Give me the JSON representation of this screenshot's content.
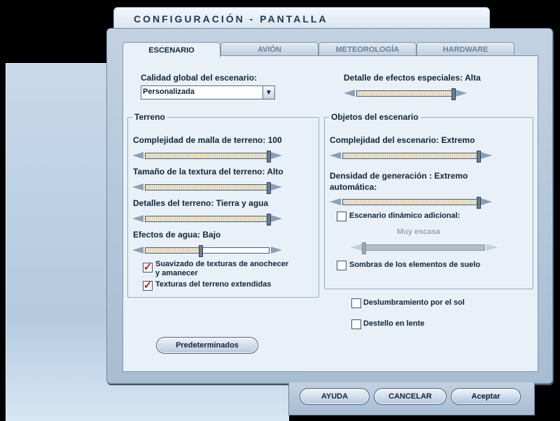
{
  "window": {
    "title": "CONFIGURACIÓN - PANTALLA"
  },
  "tabs": [
    {
      "label": "ESCENARIO",
      "active": true
    },
    {
      "label": "AVIÓN",
      "active": false
    },
    {
      "label": "METEOROLOGÍA",
      "active": false
    },
    {
      "label": "HARDWARE",
      "active": false
    }
  ],
  "global_quality": {
    "label": "Calidad global del escenario:",
    "value": "Personalizada"
  },
  "special_effects": {
    "label": "Detalle de efectos especiales: Alta",
    "level": 1.0
  },
  "terrain": {
    "title": "Terreno",
    "mesh": {
      "label": "Complejidad de malla de terreno: 100",
      "level": 1.0
    },
    "texture_size": {
      "label": "Tamaño de la textura del terreno: Alto",
      "level": 1.0
    },
    "details": {
      "label": "Detalles del terreno: Tierra y agua",
      "level": 1.0
    },
    "water": {
      "label": "Efectos de agua: Bajo",
      "level": 0.45
    },
    "smooth_textures": {
      "label_line1": "Suavizado de texturas de anochecer",
      "label_line2": "y amanecer",
      "checked": true
    },
    "extended_textures": {
      "label": "Texturas del terreno extendidas",
      "checked": true
    }
  },
  "scenery_objects": {
    "title": "Objetos del escenario",
    "complexity": {
      "label": "Complejidad del escenario: Extremo",
      "level": 1.0
    },
    "autogen": {
      "label_line1": "Densidad de generación : Extremo",
      "label_line2": "automática:",
      "level": 1.0
    },
    "dynamic_scenery": {
      "label": "Escenario dinámico adicional:",
      "checked": false
    },
    "dynamic_level": {
      "label": "Muy escasa",
      "level": 0.0
    },
    "ground_shadows": {
      "label": "Sombras de los elementos de suelo",
      "checked": false
    }
  },
  "sun_glare": {
    "label": "Deslumbramiento por el sol",
    "checked": false
  },
  "lens_flare": {
    "label": "Destello en lente",
    "checked": false
  },
  "buttons": {
    "defaults": "Predeterminados",
    "help": "AYUDA",
    "cancel": "CANCELAR",
    "accept": "Aceptar"
  }
}
